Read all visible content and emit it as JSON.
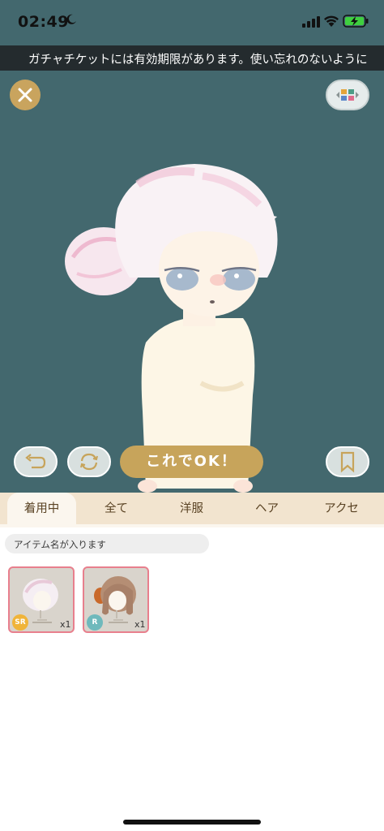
{
  "status": {
    "time": "02:49",
    "icons": [
      "moon-icon",
      "signal-icon",
      "wifi-icon",
      "battery-charging-icon"
    ]
  },
  "ticker": {
    "text": "ガチャチケットには有効期限があります。使い忘れのないように"
  },
  "toolbar": {
    "ok_label": "これでOK！",
    "icons": [
      "close-icon",
      "color-grid-icon",
      "undo-icon",
      "rotate-icon",
      "bookmark-icon"
    ]
  },
  "tabs": [
    {
      "label": "着用中",
      "active": true
    },
    {
      "label": "全て",
      "active": false
    },
    {
      "label": "洋服",
      "active": false
    },
    {
      "label": "ヘア",
      "active": false
    },
    {
      "label": "アクセ",
      "active": false
    }
  ],
  "search": {
    "text": "アイテム名が入ります"
  },
  "items": [
    {
      "rarity": "SR",
      "qty": "x1",
      "badge_color": "#f0b43a"
    },
    {
      "rarity": "R",
      "qty": "x1",
      "badge_color": "#6fb9bc"
    }
  ],
  "colors": {
    "stage": "#43686e",
    "accent_gold": "#c7a45b",
    "tab_bg": "#f2e4cf",
    "card_border": "#e87f8d"
  }
}
